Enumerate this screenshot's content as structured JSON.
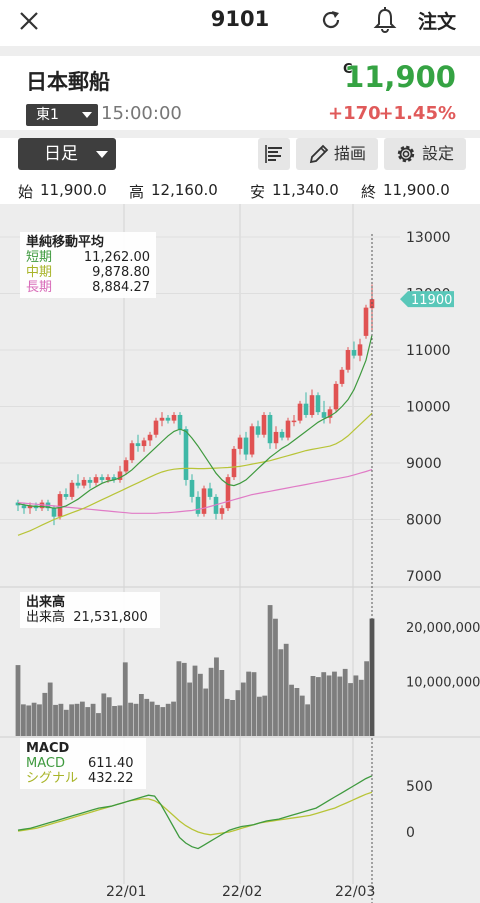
{
  "topbar": {
    "code": "9101",
    "order_label": "注文"
  },
  "stock": {
    "name": "日本郵船",
    "market": "東1",
    "time": "15:00:00",
    "c_mark": "C",
    "price": "11,900",
    "change": "+170",
    "change_pct": "+1.45%"
  },
  "toolbar": {
    "period": "日足",
    "draw_label": "描画",
    "settings_label": "設定"
  },
  "ohlc": {
    "open_label": "始",
    "open": "11,900.0",
    "high_label": "高",
    "high": "12,160.0",
    "low_label": "安",
    "low": "11,340.0",
    "close_label": "終",
    "close": "11,900.0"
  },
  "colors": {
    "up": "#e05252",
    "down": "#3fb8a6",
    "ma_short": "#3f9a3f",
    "ma_mid": "#b8c437",
    "ma_long": "#e07bc6",
    "price_tag": "#59c7b9"
  },
  "sma_legend": {
    "title": "単純移動平均",
    "short_label": "短期",
    "short_value": "11,262.00",
    "mid_label": "中期",
    "mid_value": "9,878.80",
    "long_label": "長期",
    "long_value": "8,884.27"
  },
  "volume_legend": {
    "title": "出来高",
    "label": "出来高",
    "value": "21,531,800"
  },
  "macd_legend": {
    "title": "MACD",
    "macd_label": "MACD",
    "macd_value": "611.40",
    "signal_label": "シグナル",
    "signal_value": "432.22"
  },
  "chart_data": {
    "type": "candlestick",
    "price_axis_ticks": [
      "13000",
      "12000",
      "11000",
      "10000",
      "9000",
      "8000",
      "7000"
    ],
    "price_tag": "11900",
    "volume_axis_ticks": [
      "20,000,000",
      "10,000,000"
    ],
    "macd_axis_ticks": [
      "500",
      "0"
    ],
    "x_tick_labels": [
      "22/01",
      "22/02",
      "22/03"
    ],
    "candles": [
      [
        8300,
        8350,
        8150,
        8250
      ],
      [
        8250,
        8300,
        8100,
        8200
      ],
      [
        8200,
        8300,
        8100,
        8250
      ],
      [
        8250,
        8300,
        8150,
        8200
      ],
      [
        8200,
        8350,
        8150,
        8300
      ],
      [
        8300,
        8350,
        8150,
        8200
      ],
      [
        8200,
        8250,
        7900,
        8050
      ],
      [
        8050,
        8500,
        8000,
        8450
      ],
      [
        8450,
        8550,
        8350,
        8400
      ],
      [
        8400,
        8700,
        8350,
        8650
      ],
      [
        8650,
        8800,
        8550,
        8600
      ],
      [
        8600,
        8750,
        8550,
        8700
      ],
      [
        8700,
        8750,
        8550,
        8650
      ],
      [
        8650,
        8800,
        8600,
        8750
      ],
      [
        8750,
        8800,
        8650,
        8700
      ],
      [
        8700,
        8800,
        8650,
        8750
      ],
      [
        8750,
        8800,
        8650,
        8700
      ],
      [
        8700,
        8950,
        8650,
        8850
      ],
      [
        8850,
        9100,
        8800,
        9050
      ],
      [
        9050,
        9400,
        9000,
        9350
      ],
      [
        9350,
        9500,
        9200,
        9300
      ],
      [
        9300,
        9450,
        9200,
        9400
      ],
      [
        9400,
        9550,
        9300,
        9500
      ],
      [
        9500,
        9800,
        9450,
        9750
      ],
      [
        9750,
        9900,
        9650,
        9800
      ],
      [
        9800,
        9850,
        9700,
        9750
      ],
      [
        9750,
        9900,
        9700,
        9850
      ],
      [
        9850,
        9900,
        9500,
        9600
      ],
      [
        9600,
        9650,
        8600,
        8700
      ],
      [
        8700,
        8800,
        8300,
        8400
      ],
      [
        8400,
        8500,
        8050,
        8100
      ],
      [
        8100,
        8600,
        8050,
        8550
      ],
      [
        8550,
        8650,
        8350,
        8400
      ],
      [
        8400,
        8450,
        8000,
        8100
      ],
      [
        8100,
        8250,
        8000,
        8200
      ],
      [
        8200,
        8800,
        8150,
        8750
      ],
      [
        8750,
        9300,
        8700,
        9250
      ],
      [
        9250,
        9500,
        9150,
        9450
      ],
      [
        9450,
        9550,
        9050,
        9150
      ],
      [
        9150,
        9700,
        9100,
        9650
      ],
      [
        9650,
        9750,
        9450,
        9500
      ],
      [
        9500,
        9900,
        9450,
        9850
      ],
      [
        9850,
        9900,
        9250,
        9350
      ],
      [
        9350,
        9650,
        9250,
        9550
      ],
      [
        9550,
        9600,
        9400,
        9450
      ],
      [
        9450,
        9800,
        9400,
        9750
      ],
      [
        9750,
        9850,
        9650,
        9750
      ],
      [
        9750,
        10100,
        9700,
        10050
      ],
      [
        10050,
        10250,
        9800,
        9850
      ],
      [
        9850,
        10300,
        9800,
        10200
      ],
      [
        10200,
        10250,
        9850,
        9900
      ],
      [
        9900,
        10100,
        9700,
        9800
      ],
      [
        9800,
        10000,
        9700,
        9950
      ],
      [
        9950,
        10450,
        9900,
        10400
      ],
      [
        10400,
        10700,
        10350,
        10650
      ],
      [
        10650,
        11050,
        10600,
        11000
      ],
      [
        11000,
        11150,
        10850,
        10900
      ],
      [
        10900,
        11200,
        10800,
        11100
      ],
      [
        11250,
        11800,
        11200,
        11750
      ],
      [
        11740,
        12160,
        11340,
        11900
      ]
    ],
    "ma_short": [
      8280,
      8260,
      8240,
      8230,
      8230,
      8220,
      8200,
      8210,
      8240,
      8300,
      8360,
      8440,
      8520,
      8580,
      8640,
      8680,
      8700,
      8740,
      8800,
      8880,
      8980,
      9080,
      9180,
      9280,
      9380,
      9480,
      9560,
      9600,
      9560,
      9440,
      9300,
      9140,
      8980,
      8820,
      8700,
      8620,
      8600,
      8640,
      8700,
      8800,
      8900,
      9000,
      9100,
      9180,
      9260,
      9320,
      9400,
      9480,
      9560,
      9640,
      9720,
      9780,
      9830,
      9900,
      10000,
      10120,
      10300,
      10550,
      10820,
      11262
    ],
    "ma_mid": [
      7720,
      7760,
      7800,
      7850,
      7900,
      7950,
      8000,
      8040,
      8080,
      8120,
      8160,
      8200,
      8250,
      8300,
      8350,
      8400,
      8450,
      8500,
      8550,
      8600,
      8650,
      8700,
      8750,
      8800,
      8840,
      8870,
      8890,
      8900,
      8905,
      8905,
      8900,
      8900,
      8905,
      8910,
      8915,
      8920,
      8930,
      8940,
      8960,
      8980,
      9000,
      9020,
      9040,
      9070,
      9100,
      9130,
      9160,
      9190,
      9220,
      9240,
      9260,
      9280,
      9300,
      9340,
      9400,
      9480,
      9580,
      9680,
      9780,
      9879
    ],
    "ma_long": [
      8300,
      8290,
      8280,
      8270,
      8260,
      8250,
      8240,
      8230,
      8220,
      8210,
      8200,
      8190,
      8180,
      8170,
      8160,
      8150,
      8140,
      8130,
      8120,
      8110,
      8110,
      8110,
      8110,
      8110,
      8120,
      8120,
      8130,
      8140,
      8150,
      8160,
      8180,
      8200,
      8230,
      8260,
      8290,
      8320,
      8350,
      8380,
      8410,
      8440,
      8460,
      8480,
      8500,
      8520,
      8540,
      8560,
      8580,
      8600,
      8620,
      8640,
      8660,
      8680,
      8700,
      8720,
      8740,
      8760,
      8790,
      8820,
      8850,
      8884
    ],
    "volume": [
      13000000,
      5800000,
      5600000,
      6100000,
      5800000,
      7900000,
      9800000,
      5700000,
      5900000,
      4800000,
      5800000,
      5900000,
      6300000,
      5300000,
      5900000,
      4200000,
      7800000,
      7100000,
      5500000,
      5600000,
      13500000,
      6100000,
      5900000,
      7700000,
      6800000,
      6300000,
      5700000,
      5300000,
      5900000,
      6300000,
      13700000,
      13400000,
      9800000,
      12900000,
      11400000,
      8700000,
      12500000,
      14400000,
      12100000,
      6800000,
      6600000,
      8400000,
      9800000,
      11800000,
      11700000,
      7200000,
      7400000,
      24000000,
      21500000,
      15900000,
      16900000,
      9400000,
      8800000,
      7400000,
      5800000,
      11000000,
      10800000,
      11700000,
      11100000,
      11800000,
      10900000,
      12300000,
      9700000,
      11100000,
      10300000,
      13700000,
      21531800
    ],
    "macd": [
      20,
      30,
      40,
      60,
      80,
      100,
      120,
      140,
      160,
      180,
      200,
      220,
      240,
      260,
      270,
      280,
      300,
      320,
      340,
      360,
      380,
      400,
      390,
      300,
      180,
      60,
      -60,
      -120,
      -160,
      -180,
      -140,
      -100,
      -60,
      -20,
      20,
      40,
      60,
      70,
      80,
      100,
      120,
      130,
      140,
      160,
      180,
      200,
      220,
      240,
      260,
      300,
      340,
      380,
      420,
      460,
      500,
      540,
      580,
      611
    ],
    "signal": [
      10,
      20,
      30,
      40,
      60,
      80,
      100,
      120,
      140,
      160,
      180,
      200,
      220,
      240,
      260,
      280,
      300,
      320,
      340,
      350,
      360,
      360,
      340,
      300,
      240,
      180,
      120,
      70,
      30,
      0,
      -20,
      -30,
      -20,
      -10,
      0,
      20,
      40,
      60,
      80,
      100,
      110,
      120,
      130,
      140,
      150,
      160,
      170,
      180,
      200,
      220,
      240,
      260,
      290,
      320,
      350,
      380,
      410,
      432
    ]
  }
}
